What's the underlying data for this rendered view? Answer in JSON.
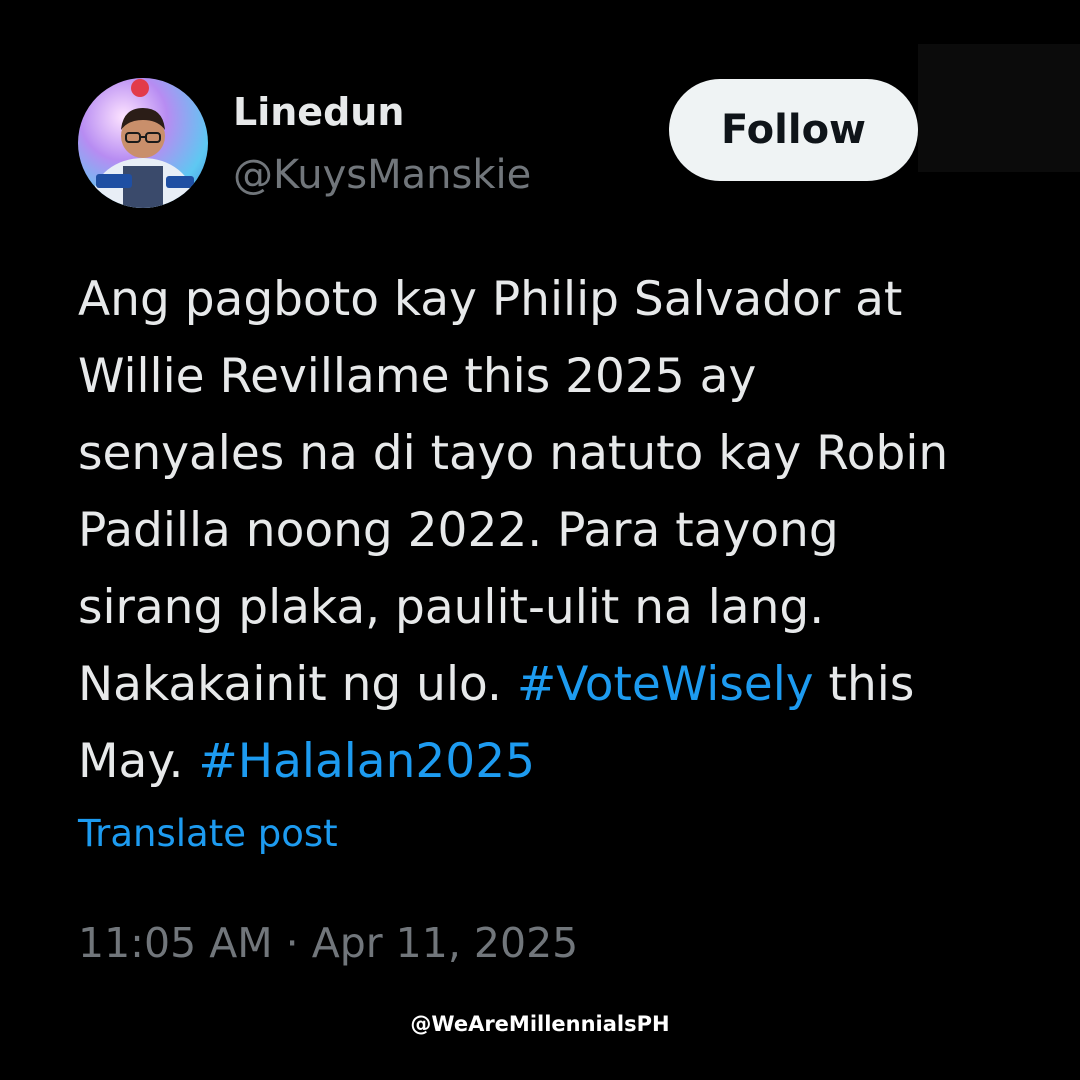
{
  "profile": {
    "name": "Linedun",
    "handle": "@KuysManskie",
    "avatar_icon": "profile-photo"
  },
  "follow_button": {
    "label": "Follow"
  },
  "tweet": {
    "lines": [
      [
        {
          "text": "Ang pagboto kay Philip Salvador at",
          "type": "text"
        }
      ],
      [
        {
          "text": "Willie Revillame this 2025 ay",
          "type": "text"
        }
      ],
      [
        {
          "text": "senyales na di tayo natuto kay Robin",
          "type": "text"
        }
      ],
      [
        {
          "text": "Padilla noong 2022. Para tayong",
          "type": "text"
        }
      ],
      [
        {
          "text": "sirang plaka, paulit-ulit na lang.",
          "type": "text"
        }
      ],
      [
        {
          "text": "Nakakainit ng ulo. ",
          "type": "text"
        },
        {
          "text": "#VoteWisely",
          "type": "hashtag"
        },
        {
          "text": " this",
          "type": "text"
        }
      ],
      [
        {
          "text": "May. ",
          "type": "text"
        },
        {
          "text": "#Halalan2025",
          "type": "hashtag"
        }
      ]
    ]
  },
  "translate_label": "Translate post",
  "timestamp": "11:05 AM · Apr 11, 2025",
  "watermark": "@WeAreMillennialsPH",
  "colors": {
    "background": "#000000",
    "text_primary": "#e7e9ea",
    "text_secondary": "#71767b",
    "accent": "#1d9bf0",
    "follow_bg": "#eff3f4"
  }
}
